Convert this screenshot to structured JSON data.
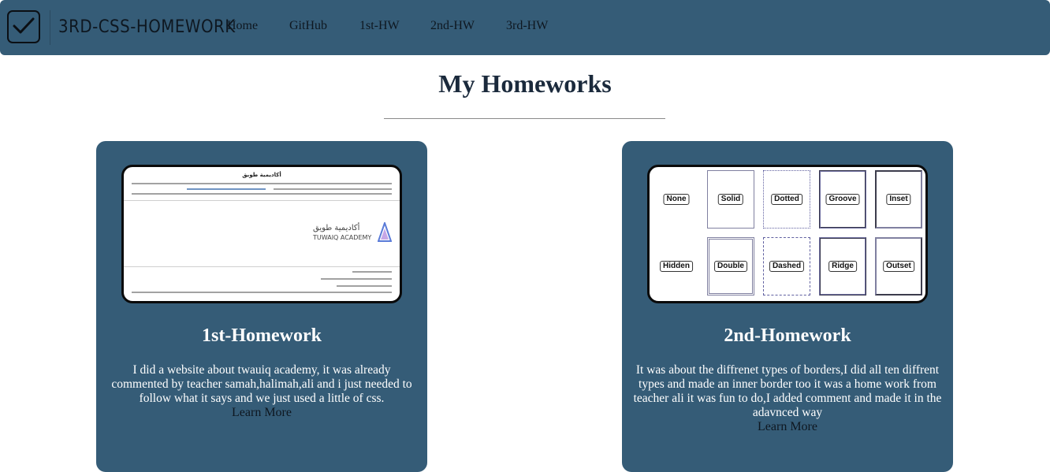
{
  "brand": {
    "name": "3RD-CSS-HOMEWORK",
    "icon": "checkbox-icon"
  },
  "nav": {
    "links": [
      {
        "label": "Home"
      },
      {
        "label": "GitHub"
      },
      {
        "label": "1st-HW"
      },
      {
        "label": "2nd-HW"
      },
      {
        "label": "3rd-HW"
      }
    ]
  },
  "colors": {
    "navbar": "#355c77",
    "card": "#355c77",
    "title": "#1b2a3c"
  },
  "page": {
    "title": "My Homeworks"
  },
  "cards": [
    {
      "title": "1st-Homework",
      "description": "I did a website about twauiq academy, it was already commented by teacher samah,halimah,ali and i just needed to follow what it says and we just used a little of css.",
      "link": "Learn More",
      "thumbnail": {
        "heading": "أكاديمية طويق",
        "logo_ar": "أكاديمية طويق",
        "logo_en": "TUWAIQ ACADEMY"
      }
    },
    {
      "title": "2nd-Homework",
      "description": "It was about the diffrenet types of borders,I did all ten diffrent types and made an inner border too it was a home work from teacher ali it was fun to do,I added comment and made it in the adavnced way",
      "link": "Learn More",
      "thumbnail": {
        "boxes": [
          "None",
          "Solid",
          "Dotted",
          "Groove",
          "Inset",
          "Hidden",
          "Double",
          "Dashed",
          "Ridge",
          "Outset"
        ]
      }
    }
  ]
}
